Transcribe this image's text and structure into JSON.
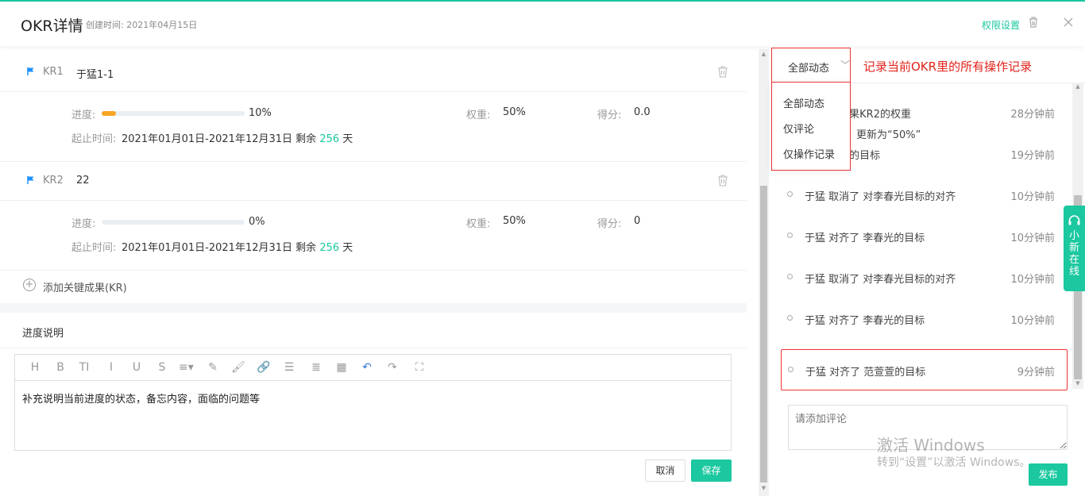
{
  "header": {
    "title": "OKR详情",
    "created_label": "创建时间: 2021年04月15日",
    "permission_link": "权限设置"
  },
  "key_results": [
    {
      "tag": "KR1",
      "name": "于猛1-1",
      "progress_label": "进度:",
      "progress": 0.1,
      "progress_text": "10%",
      "weight_label": "权重:",
      "weight": "50%",
      "score_label": "得分:",
      "score": "0.0",
      "date_label": "起止时间:",
      "date_range": "2021年01月01日-2021年12月31日 剩余",
      "remaining_days": "256",
      "days_unit": "天"
    },
    {
      "tag": "KR2",
      "name": "22",
      "progress_label": "进度:",
      "progress": 0.0,
      "progress_text": "0%",
      "weight_label": "权重:",
      "weight": "50%",
      "score_label": "得分:",
      "score": "0",
      "date_label": "起止时间:",
      "date_range": "2021年01月01日-2021年12月31日 剩余",
      "remaining_days": "256",
      "days_unit": "天"
    }
  ],
  "add_kr_label": "添加关键成果(KR)",
  "progress_section": {
    "title": "进度说明",
    "editor_content": "补充说明当前进度的状态，备忘内容，面临的问题等",
    "toolbar": [
      "H",
      "B",
      "TI",
      "I",
      "U",
      "S",
      "≡▾",
      "✎",
      "🖌",
      "🔗",
      "☰",
      "≣",
      "▦",
      "↶",
      "↷",
      "⛶"
    ],
    "cancel_label": "取消",
    "save_label": "保存"
  },
  "activity": {
    "filter_selected": "全部动态",
    "filter_options": [
      "全部动态",
      "仅评论",
      "仅操作记录"
    ],
    "annotation": "记录当前OKR里的所有操作记录",
    "items": [
      {
        "text": "〃 关键成果KR2的权重",
        "text2": "更新为“50%”",
        "time": "28分钟前"
      },
      {
        "text": "〃 李春光的目标",
        "time": "19分钟前"
      },
      {
        "text": "于猛 取消了 对李春光目标的对齐",
        "time": "10分钟前"
      },
      {
        "text": "于猛 对齐了 李春光的目标",
        "time": "10分钟前"
      },
      {
        "text": "于猛 取消了 对李春光目标的对齐",
        "time": "10分钟前"
      },
      {
        "text": "于猛 对齐了 李春光的目标",
        "time": "10分钟前"
      },
      {
        "text": "于猛 对齐了 范萱萱的目标",
        "time": "9分钟前"
      }
    ],
    "comment_placeholder": "请添加评论",
    "publish_label": "发布"
  },
  "help_widget": {
    "label": "小新在线"
  },
  "watermark": {
    "line1": "激活 Windows",
    "line2": "转到“设置”以激活 Windows。"
  },
  "colors": {
    "accent": "#1bc8a0",
    "annotation": "#e2231a",
    "progress_fill": "#f5a623",
    "flag": "#1e90ff"
  }
}
